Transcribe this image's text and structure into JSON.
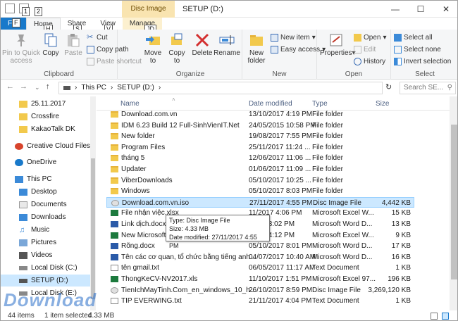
{
  "window": {
    "title": "SETUP (D:)",
    "context_tool": "Disc Image Tools",
    "keytips": {
      "qa1": "1",
      "qa2": "2",
      "file": "F",
      "home": "H",
      "share": "S",
      "view": "V",
      "manage": "JD"
    }
  },
  "tabs": {
    "file": "File",
    "home": "Home",
    "share": "Share",
    "view": "View",
    "manage": "Manage"
  },
  "ribbon": {
    "clipboard": {
      "label": "Clipboard",
      "pin": "Pin to Quick access",
      "copy": "Copy",
      "paste": "Paste",
      "cut": "Cut",
      "copy_path": "Copy path",
      "paste_shortcut": "Paste shortcut"
    },
    "organize": {
      "label": "Organize",
      "move_to": "Move to",
      "copy_to": "Copy to",
      "delete": "Delete",
      "rename": "Rename"
    },
    "new": {
      "label": "New",
      "new_folder": "New folder",
      "new_item": "New item",
      "easy_access": "Easy access"
    },
    "open": {
      "label": "Open",
      "properties": "Properties",
      "open": "Open",
      "edit": "Edit",
      "history": "History"
    },
    "select": {
      "label": "Select",
      "select_all": "Select all",
      "select_none": "Select none",
      "invert": "Invert selection"
    }
  },
  "address": {
    "segments": [
      "This PC",
      "SETUP (D:)"
    ],
    "search_placeholder": "Search SE..."
  },
  "nav": {
    "items": [
      "25.11.2017",
      "Crossfire",
      "KakaoTalk DK",
      "Creative Cloud Files",
      "OneDrive",
      "This PC",
      "Desktop",
      "Documents",
      "Downloads",
      "Music",
      "Pictures",
      "Videos",
      "Local Disk (C:)",
      "SETUP (D:)",
      "Local Disk (E:)"
    ]
  },
  "columns": {
    "name": "Name",
    "date": "Date modified",
    "type": "Type",
    "size": "Size"
  },
  "files": [
    {
      "name": "Download.com.vn",
      "date": "13/10/2017 4:19 PM",
      "type": "File folder",
      "size": ""
    },
    {
      "name": "IDM 6.23 Build 12 Full-SinhVienIT.Net",
      "date": "24/05/2015 10:58 PM",
      "type": "File folder",
      "size": ""
    },
    {
      "name": "New folder",
      "date": "19/08/2017 7:55 PM",
      "type": "File folder",
      "size": ""
    },
    {
      "name": "Program Files",
      "date": "25/11/2017 11:24 ...",
      "type": "File folder",
      "size": ""
    },
    {
      "name": "tháng 5",
      "date": "12/06/2017 11:06 ...",
      "type": "File folder",
      "size": ""
    },
    {
      "name": "Updater",
      "date": "01/06/2017 11:09 ...",
      "type": "File folder",
      "size": ""
    },
    {
      "name": "ViberDownloads",
      "date": "05/10/2017 10:25 ...",
      "type": "File folder",
      "size": ""
    },
    {
      "name": "Windows",
      "date": "05/10/2017 8:03 PM",
      "type": "File folder",
      "size": ""
    },
    {
      "name": "Download.com.vn.iso",
      "date": "27/11/2017 4:55 PM",
      "type": "Disc Image File",
      "size": "4,442 KB"
    },
    {
      "name": "File nhận việc.xlsx",
      "date": "11/2017 4:06 PM",
      "type": "Microsoft Excel W...",
      "size": "15 KB"
    },
    {
      "name": "Link dịch.docx",
      "date": "/2017 3:02 PM",
      "type": "Microsoft Word D...",
      "size": "13 KB"
    },
    {
      "name": "New Microsoft",
      "date": "/2017 4:12 PM",
      "type": "Microsoft Excel W...",
      "size": "9 KB"
    },
    {
      "name": "Rõng.docx",
      "date": "05/10/2017 8:01 PM",
      "type": "Microsoft Word D...",
      "size": "17 KB"
    },
    {
      "name": "Tên các cơ quan, tổ chức bằng tiếng anh...",
      "date": "04/07/2017 10:40 AM",
      "type": "Microsoft Word D...",
      "size": "16 KB"
    },
    {
      "name": "tên gmail.txt",
      "date": "06/05/2017 11:17 AM",
      "type": "Text Document",
      "size": "1 KB"
    },
    {
      "name": "ThongKeCV-NV2017.xls",
      "date": "11/10/2017 1:51 PM",
      "type": "Microsoft Excel 97...",
      "size": "196 KB"
    },
    {
      "name": "TienIchMayTinh.Com_en_windows_10_h...",
      "date": "26/10/2017 8:59 PM",
      "type": "Disc Image File",
      "size": "3,269,120 KB"
    },
    {
      "name": "TIP EVERWING.txt",
      "date": "21/11/2017 4:04 PM",
      "type": "Text Document",
      "size": "1 KB"
    }
  ],
  "tooltip": {
    "type": "Type: Disc Image File",
    "size": "Size: 4.33 MB",
    "date": "Date modified: 27/11/2017 4:55 PM"
  },
  "status": {
    "items": "44 items",
    "selected": "1 item selected",
    "size": "4.33 MB"
  },
  "watermark": "Download",
  "colors": {
    "accent": "#1979ca",
    "selection": "#cce8ff",
    "manage_tab": "#f9e4b0"
  }
}
